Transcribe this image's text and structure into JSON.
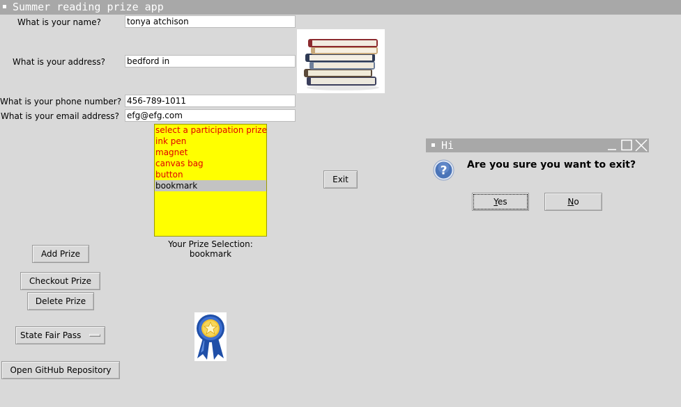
{
  "window": {
    "title": "Summer reading prize app"
  },
  "form": {
    "name_label": "What is your name?",
    "name_value": "tonya atchison",
    "address_label": "What is your address?",
    "address_value": "bedford in",
    "phone_label": "What is your phone number?",
    "phone_value": "456-789-1011",
    "email_label": "What is your email address?",
    "email_value": "efg@efg.com"
  },
  "images": {
    "books": "stack-of-books-image",
    "ribbon": "prize-ribbon-image"
  },
  "prize_list": {
    "items": [
      "select a participation prize",
      "ink pen",
      "magnet",
      "canvas bag",
      "button",
      "bookmark"
    ],
    "selected": "bookmark"
  },
  "selection": {
    "caption": "Your Prize Selection:",
    "value": "bookmark"
  },
  "buttons": {
    "exit": "Exit",
    "add_prize": "Add Prize",
    "checkout_prize": "Checkout Prize",
    "delete_prize": "Delete Prize",
    "open_github": "Open GitHub Repository"
  },
  "option_menu": {
    "value": "State Fair Pass"
  },
  "dialog": {
    "title": "Hi",
    "message": "Are you sure you want to exit?",
    "yes": "Yes",
    "no": "No",
    "icon": "question-icon"
  },
  "colors": {
    "background": "#d9d9d9",
    "titlebar": "#a8a8a8",
    "listbox_bg": "#ffff00",
    "listbox_text": "#e00000",
    "listbox_selected": "#c3c3c3"
  }
}
